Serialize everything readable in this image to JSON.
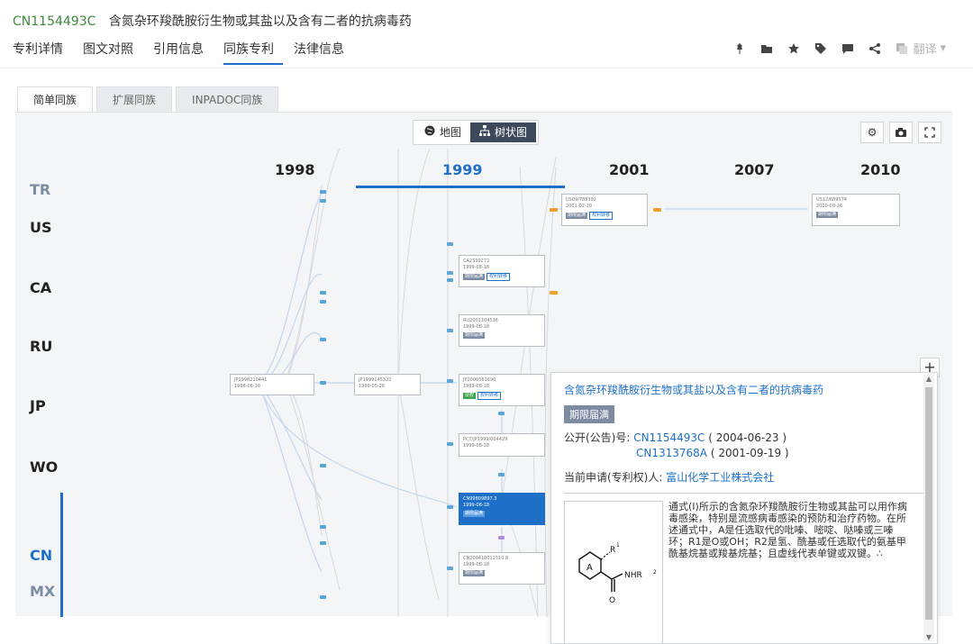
{
  "header": {
    "pub_id": "CN1154493C",
    "title": "含氮杂环羧酰胺衍生物或其盐以及含有二者的抗病毒药"
  },
  "nav_tabs": [
    "专利详情",
    "图文对照",
    "引用信息",
    "同族专利",
    "法律信息"
  ],
  "active_nav_tab": "同族专利",
  "toolbar": {
    "icons": [
      "pin-icon",
      "folder-icon",
      "star-icon",
      "tag-icon",
      "comment-icon",
      "share-icon"
    ],
    "translate_label": "翻译"
  },
  "family_tabs": [
    "简单同族",
    "扩展同族",
    "INPADOC同族"
  ],
  "active_family_tab": "简单同族",
  "view_switch": {
    "map_label": "地图",
    "tree_label": "树状图",
    "active": "树状图"
  },
  "years": [
    "1998",
    "1999",
    "2001",
    "2007",
    "2010"
  ],
  "active_year": "1999",
  "countries": [
    "TR",
    "US",
    "CA",
    "RU",
    "JP",
    "WO",
    "CN",
    "MX"
  ],
  "active_country": "CN",
  "nodes": [
    {
      "id": "jp1",
      "number": "JP1998210441",
      "date": "1998-06-20",
      "badges": []
    },
    {
      "id": "jp2",
      "number": "JP1999145322",
      "date": "1999-05-26",
      "badges": []
    },
    {
      "id": "us1",
      "number": "US09/788392",
      "date": "2001-02-20",
      "badges": [
        "期限届满",
        "权利转移"
      ]
    },
    {
      "id": "us2",
      "number": "US12/689574",
      "date": "2010-09-26",
      "badges": [
        "期限届满"
      ]
    },
    {
      "id": "ca1",
      "number": "CA2339272",
      "date": "1999-08-18",
      "badges": [
        "期限届满",
        "权利转移"
      ]
    },
    {
      "id": "ru1",
      "number": "RU2001104516",
      "date": "1999-08-18",
      "badges": [
        "期限届满"
      ]
    },
    {
      "id": "jp3",
      "number": "JP2000561690",
      "date": "1999-08-18",
      "badges": [
        "授权",
        "权利转移"
      ]
    },
    {
      "id": "wo1",
      "number": "PCT/JP1999/004429",
      "date": "1999-08-18",
      "badges": []
    },
    {
      "id": "cn1",
      "number": "CN99809897.3",
      "date": "1999-08-18",
      "badges": [
        "期限届满"
      ]
    },
    {
      "id": "cn2",
      "number": "CN200410012510.8",
      "date": "1999-08-18",
      "badges": [
        "期限届满"
      ]
    }
  ],
  "popup": {
    "title": "含氮杂环羧酰胺衍生物或其盐以及含有二者的抗病毒药",
    "status": "期限届满",
    "pub_label": "公开(公告)号:",
    "pub_numbers": [
      {
        "number": "CN1154493C",
        "date": "( 2004-06-23 )"
      },
      {
        "number": "CN1313768A",
        "date": "( 2001-09-19 )"
      }
    ],
    "assignee_label": "当前申请(专利权)人:",
    "assignee": "富山化学工业株式会社",
    "abstract": "通式(I)所示的含氮杂环羧酰胺衍生物或其盐可以用作病毒感染，特别是流感病毒感染的预防和治疗药物。在所述通式中，A是任选取代的吡嗪、嘧啶、哒嗪或三嗪环；R1是O或OH；R2是氢、酰基或任选取代的氨基甲酰基烷基或羧基烷基；且虚线代表单键或双键。∴"
  }
}
